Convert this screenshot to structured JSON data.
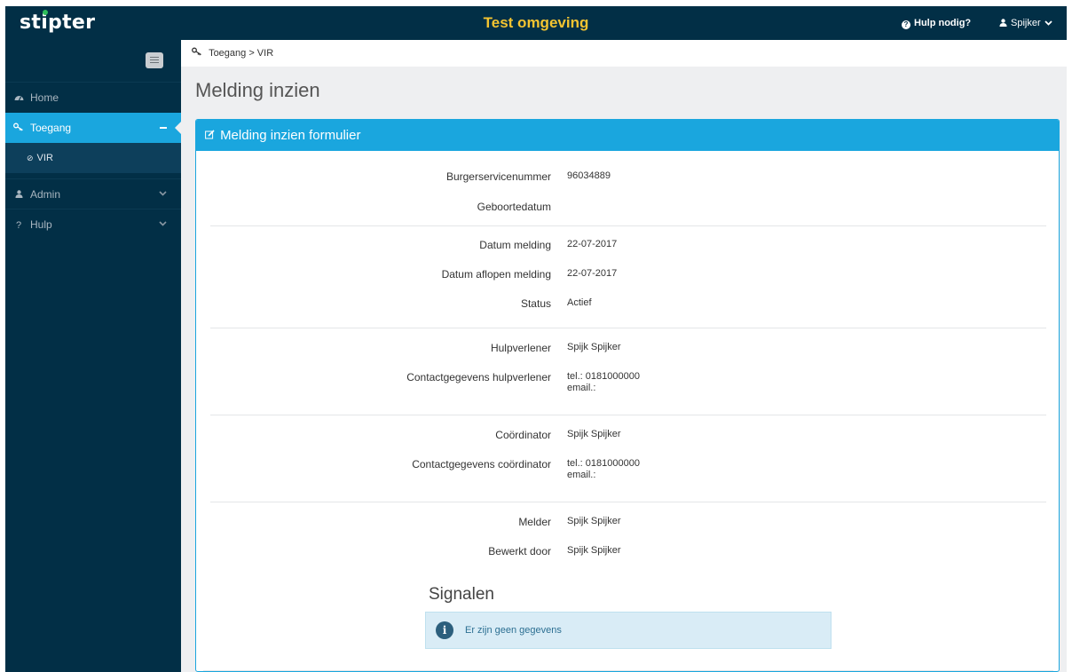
{
  "header": {
    "logo": "stipter",
    "environment": "Test omgeving",
    "help_label": "Hulp nodig?",
    "user_label": "Spijker"
  },
  "sidebar": {
    "items": [
      {
        "label": "Home",
        "icon": "dashboard-icon"
      },
      {
        "label": "Toegang",
        "icon": "key-icon",
        "active": true
      },
      {
        "label": "VIR",
        "icon": "circle-check-icon",
        "sub": true
      },
      {
        "label": "Admin",
        "icon": "user-icon"
      },
      {
        "label": "Hulp",
        "icon": "question-icon"
      }
    ]
  },
  "breadcrumb": "Toegang > VIR",
  "page_title": "Melding inzien",
  "panel": {
    "title": "Melding inzien formulier",
    "fields": [
      {
        "label": "Burgerservicenummer",
        "value": "96034889"
      },
      {
        "label": "Geboortedatum",
        "value": ""
      },
      {
        "label": "Datum melding",
        "value": "22-07-2017"
      },
      {
        "label": "Datum aflopen melding",
        "value": "22-07-2017"
      },
      {
        "label": "Status",
        "value": "Actief"
      },
      {
        "label": "Hulpverlener",
        "value": "Spijk Spijker"
      },
      {
        "label": "Contactgegevens hulpverlener",
        "value": "tel.: 0181000000",
        "value2": "email.:"
      },
      {
        "label": "Coördinator",
        "value": "Spijk Spijker"
      },
      {
        "label": "Contactgegevens coördinator",
        "value": "tel.: 0181000000",
        "value2": "email.:"
      },
      {
        "label": "Melder",
        "value": "Spijk Spijker"
      },
      {
        "label": "Bewerkt door",
        "value": "Spijk Spijker"
      }
    ],
    "signals_title": "Signalen",
    "signals_empty": "Er zijn geen gegevens"
  },
  "colors": {
    "navy": "#022f46",
    "accent": "#1aa6de",
    "env_yellow": "#f4c431"
  }
}
